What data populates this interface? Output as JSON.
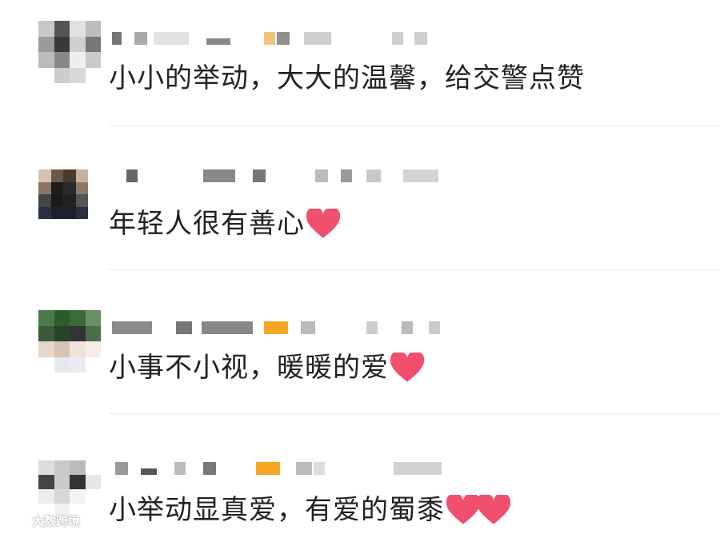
{
  "comments": [
    {
      "text": "小小的举动，大大的温馨，给交警点赞",
      "hearts": 0
    },
    {
      "text": "年轻人很有善心",
      "hearts": 1
    },
    {
      "text": "小事不小视，暖暖的爱",
      "hearts": 1
    },
    {
      "text": "小举动显真爱，有爱的蜀黍",
      "hearts": 2
    }
  ],
  "icons": {
    "heart": "heart-emoji-icon",
    "watermark_logo": "watermark-logo-icon"
  },
  "watermark": {
    "text": "大数跨境"
  },
  "colors": {
    "heart": "#f0506e",
    "text": "#222222",
    "divider": "#ebebeb",
    "badge": "#f5a623"
  }
}
